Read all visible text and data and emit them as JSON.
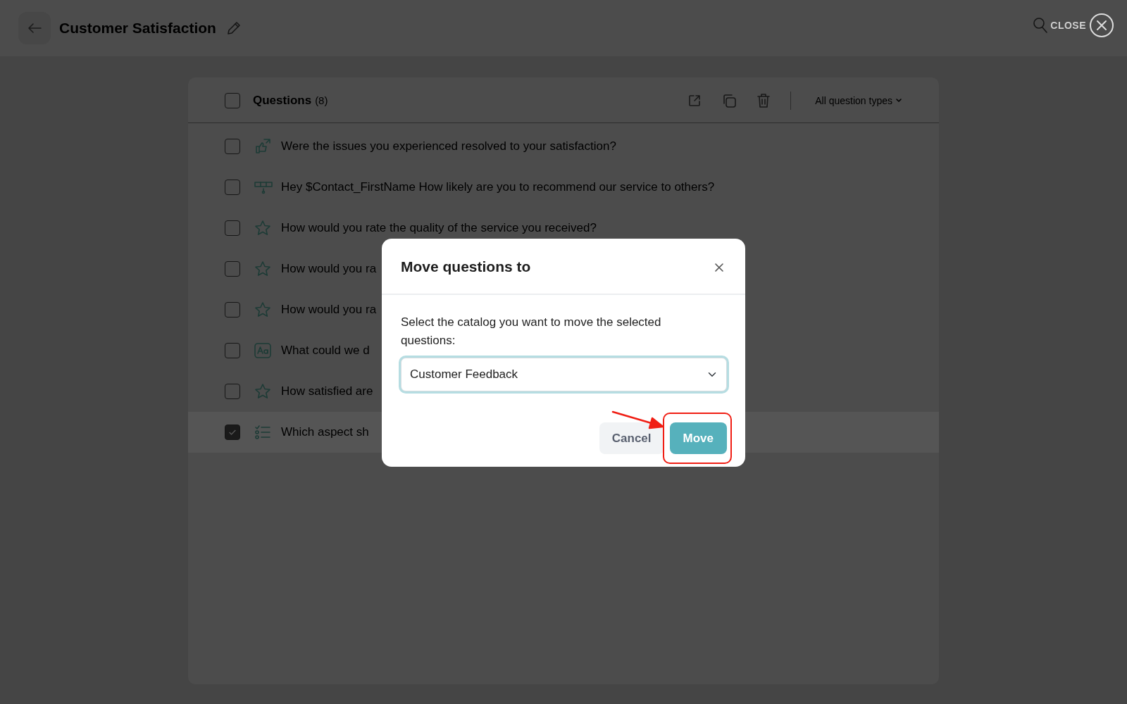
{
  "header": {
    "title": "Customer Satisfaction",
    "close_label": "CLOSE"
  },
  "questions": {
    "title": "Questions",
    "count": "(8)",
    "all_checked": false,
    "filter": "All question types",
    "items": [
      {
        "kind": "thumbs",
        "text": "Were the issues you experienced resolved to your satisfaction?",
        "checked": false
      },
      {
        "kind": "scale",
        "text": "Hey $Contact_FirstName  How likely are you to recommend our service to others?",
        "checked": false
      },
      {
        "kind": "star",
        "text": "How would you rate the quality of the service you received?",
        "checked": false
      },
      {
        "kind": "star",
        "text": "How would you ra",
        "checked": false
      },
      {
        "kind": "star",
        "text": "How would you ra",
        "checked": false
      },
      {
        "kind": "text",
        "text": "What could we d",
        "checked": false
      },
      {
        "kind": "star",
        "text": "How satisfied are",
        "checked": false
      },
      {
        "kind": "choice",
        "text": "Which aspect sh",
        "checked": true
      }
    ]
  },
  "dialog": {
    "title": "Move questions to",
    "prompt": "Select the catalog you want to move the selected questions:",
    "catalog": "Customer Feedback",
    "cancel": "Cancel",
    "confirm": "Move"
  }
}
